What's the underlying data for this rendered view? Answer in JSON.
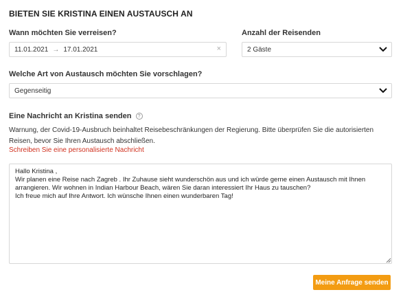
{
  "title": "BIETEN SIE KRISTINA EINEN AUSTAUSCH AN",
  "travel": {
    "label": "Wann möchten Sie verreisen?",
    "start_date": "11.01.2021",
    "arrow": "→",
    "end_date": "17.01.2021",
    "clear": "×"
  },
  "guests": {
    "label": "Anzahl der Reisenden",
    "value": "2 Gäste"
  },
  "exchange_type": {
    "label": "Welche Art von Austausch möchten Sie vorschlagen?",
    "value": "Gegenseitig"
  },
  "message": {
    "label": "Eine Nachricht an Kristina senden",
    "help": "?",
    "warning": "Warnung, der Covid-19-Ausbruch beinhaltet Reisebeschränkungen der Regierung. Bitte überprüfen Sie die autorisierten Reisen, bevor Sie Ihren Austausch abschließen.",
    "personal_link": "Schreiben Sie eine personalisierte Nachricht",
    "body": "Hallo Kristina ,\nWir planen eine Reise nach Zagreb . Ihr Zuhause sieht wunderschön aus und ich würde gerne einen Austausch mit Ihnen arrangieren. Wir wohnen in Indian Harbour Beach, wären Sie daran interessiert Ihr Haus zu tauschen?\nIch freue mich auf Ihre Antwort. Ich wünsche Ihnen einen wunderbaren Tag!"
  },
  "send_button": "Meine Anfrage senden",
  "colors": {
    "accent": "#f39c12",
    "link_red": "#d0311f"
  }
}
